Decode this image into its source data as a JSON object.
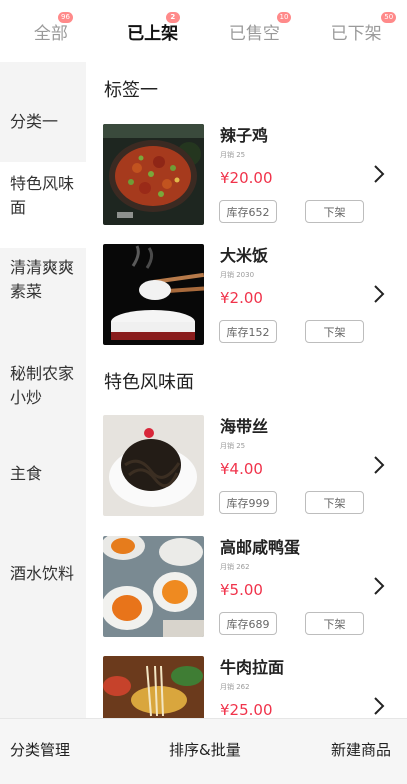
{
  "tabs": [
    {
      "label": "全部",
      "badge": "96"
    },
    {
      "label": "已上架",
      "badge": "2",
      "active": true
    },
    {
      "label": "已售空",
      "badge": "10"
    },
    {
      "label": "已下架",
      "badge": "50"
    }
  ],
  "sidebar": {
    "items": [
      {
        "label": "分类一"
      },
      {
        "label": "特色风味面",
        "active": true
      },
      {
        "label": "清清爽爽素菜"
      },
      {
        "label": "秘制农家小炒"
      },
      {
        "label": "主食"
      },
      {
        "label": "酒水饮料"
      }
    ]
  },
  "sections": [
    {
      "title": "标签一"
    },
    {
      "title": "特色风味面"
    }
  ],
  "products": [
    {
      "name": "辣子鸡",
      "sales": "月销 25",
      "price": "¥20.00",
      "stock": "库存652",
      "off_label": "下架"
    },
    {
      "name": "大米饭",
      "sales": "月销 2030",
      "price": "¥2.00",
      "stock": "库存152",
      "off_label": "下架"
    },
    {
      "name": "海带丝",
      "sales": "月销 25",
      "price": "¥4.00",
      "stock": "库存999",
      "off_label": "下架"
    },
    {
      "name": "高邮咸鸭蛋",
      "sales": "月销 262",
      "price": "¥5.00",
      "stock": "库存689",
      "off_label": "下架"
    },
    {
      "name": "牛肉拉面",
      "sales": "月销 262",
      "price": "¥25.00",
      "stock": "",
      "off_label": ""
    }
  ],
  "bottom_bar": {
    "category_manage": "分类管理",
    "sort_batch": "排序&批量",
    "new_product": "新建商品"
  },
  "colors": {
    "price": "#f0334b",
    "badge": "#ff8a8a"
  }
}
